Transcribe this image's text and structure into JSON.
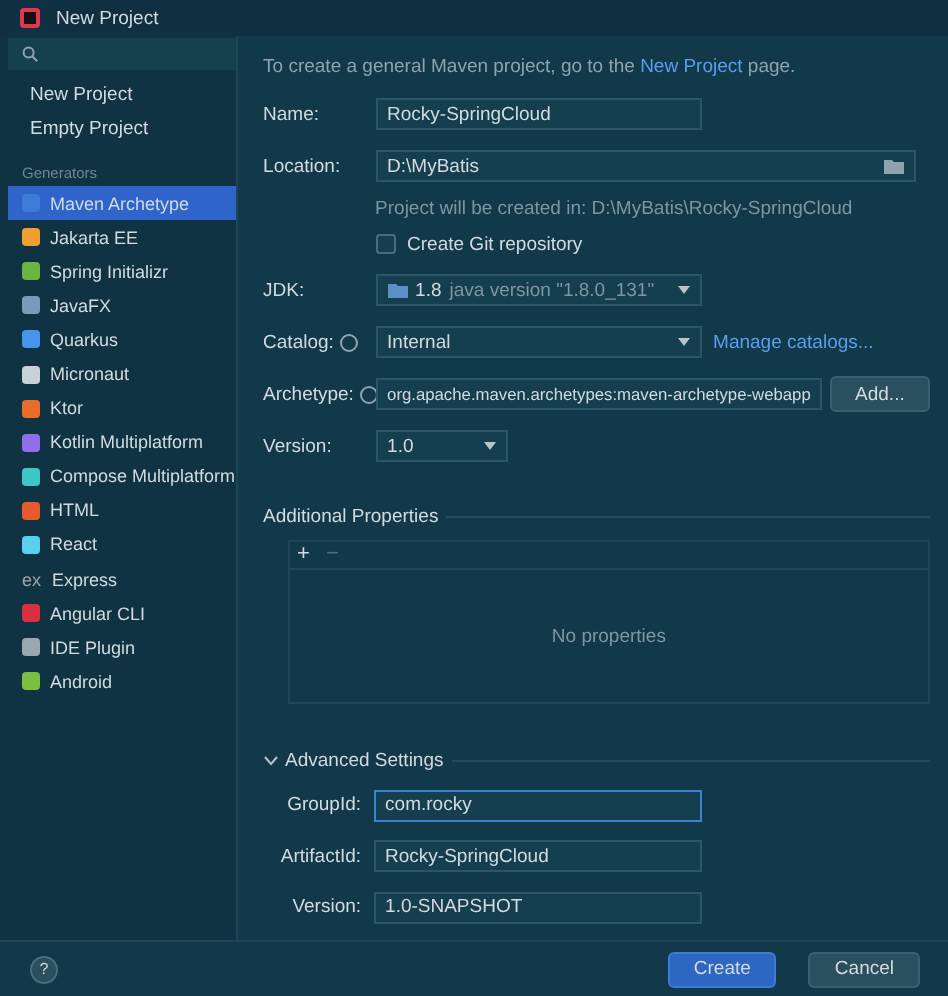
{
  "window": {
    "title": "New Project"
  },
  "sidebar": {
    "top_items": [
      {
        "label": "New Project",
        "selected": false
      },
      {
        "label": "Empty Project",
        "selected": false
      }
    ],
    "section_title": "Generators",
    "items": [
      {
        "label": "Maven Archetype",
        "selected": true,
        "color": "#3d7bd9"
      },
      {
        "label": "Jakarta EE",
        "selected": false,
        "color": "#f0a030"
      },
      {
        "label": "Spring Initializr",
        "selected": false,
        "color": "#6db33f"
      },
      {
        "label": "JavaFX",
        "selected": false,
        "color": "#7a9bb8"
      },
      {
        "label": "Quarkus",
        "selected": false,
        "color": "#4695eb"
      },
      {
        "label": "Micronaut",
        "selected": false,
        "color": "#c8d0d8"
      },
      {
        "label": "Ktor",
        "selected": false,
        "color": "#e86d2b"
      },
      {
        "label": "Kotlin Multiplatform",
        "selected": false,
        "color": "#8f6ee8"
      },
      {
        "label": "Compose Multiplatform",
        "selected": false,
        "color": "#3ec7c7"
      },
      {
        "label": "HTML",
        "selected": false,
        "color": "#e65a2c"
      },
      {
        "label": "React",
        "selected": false,
        "color": "#5ad0f0"
      },
      {
        "label": "Express",
        "kind": "text",
        "icon_label": "ex",
        "selected": false,
        "color": "#9aa8b0"
      },
      {
        "label": "Angular CLI",
        "selected": false,
        "color": "#d83040"
      },
      {
        "label": "IDE Plugin",
        "selected": false,
        "color": "#9aa8b0"
      },
      {
        "label": "Android",
        "selected": false,
        "color": "#7ac040"
      }
    ]
  },
  "intro": {
    "before": "To create a general Maven project, go to the",
    "link": "New Project",
    "after": "page."
  },
  "form": {
    "name": {
      "label": "Name:",
      "value": "Rocky-SpringCloud"
    },
    "location": {
      "label": "Location:",
      "value": "D:\\MyBatis",
      "hint": "Project will be created in: D:\\MyBatis\\Rocky-SpringCloud"
    },
    "git": {
      "label": "Create Git repository",
      "checked": false
    },
    "jdk": {
      "label": "JDK:",
      "version": "1.8",
      "detail": "java version \"1.8.0_131\""
    },
    "catalog": {
      "label": "Catalog:",
      "value": "Internal",
      "link": "Manage catalogs..."
    },
    "archetype": {
      "label": "Archetype:",
      "value": "org.apache.maven.archetypes:maven-archetype-webapp",
      "button": "Add..."
    },
    "version": {
      "label": "Version:",
      "value": "1.0"
    }
  },
  "properties": {
    "title": "Additional Properties",
    "add": "+",
    "remove": "−",
    "empty": "No properties"
  },
  "advanced": {
    "title": "Advanced Settings",
    "expanded": true,
    "fields": [
      {
        "label": "GroupId:",
        "value": "com.rocky",
        "focused": true
      },
      {
        "label": "ArtifactId:",
        "value": "Rocky-SpringCloud",
        "focused": false
      },
      {
        "label": "Version:",
        "value": "1.0-SNAPSHOT",
        "focused": false
      }
    ]
  },
  "footer": {
    "help": "?",
    "buttons": [
      {
        "label": "Create",
        "primary": true
      },
      {
        "label": "Cancel",
        "primary": false
      }
    ]
  }
}
